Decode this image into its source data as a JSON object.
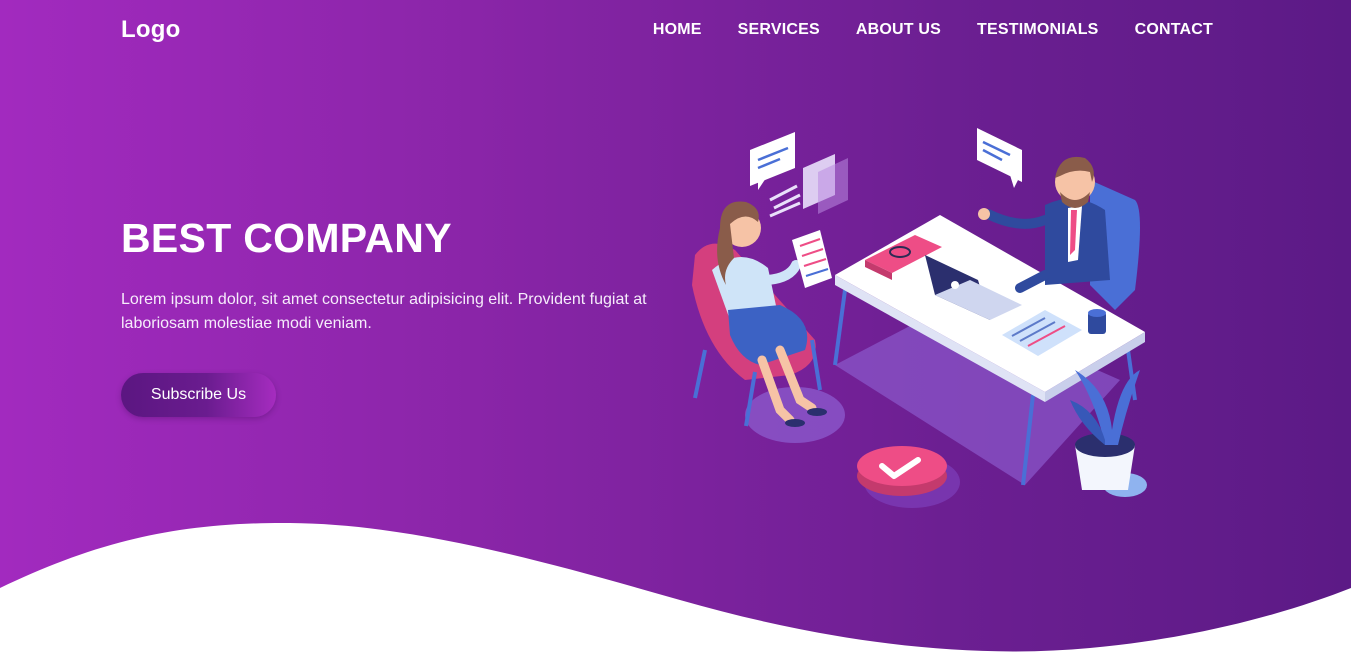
{
  "brand": {
    "logo_text": "Logo"
  },
  "nav": {
    "items": [
      {
        "label": "HOME"
      },
      {
        "label": "SERVICES"
      },
      {
        "label": "ABOUT US"
      },
      {
        "label": "TESTIMONIALS"
      },
      {
        "label": "CONTACT"
      }
    ]
  },
  "hero": {
    "title": "BEST COMPANY",
    "description": "Lorem ipsum dolor, sit amet consectetur adipisicing elit. Provident fugiat at laboriosam molestiae modi veniam.",
    "cta_label": "Subscribe Us"
  },
  "colors": {
    "gradient_start": "#a22abf",
    "gradient_end": "#5c1a86",
    "accent_pink": "#ee4d86",
    "accent_blue": "#4a6fd6"
  },
  "illustration": {
    "description_icons": [
      "woman-in-chair-icon",
      "man-at-desk-icon",
      "laptop-icon",
      "chat-bubble-icon",
      "plant-icon",
      "checkmark-badge-icon"
    ]
  }
}
